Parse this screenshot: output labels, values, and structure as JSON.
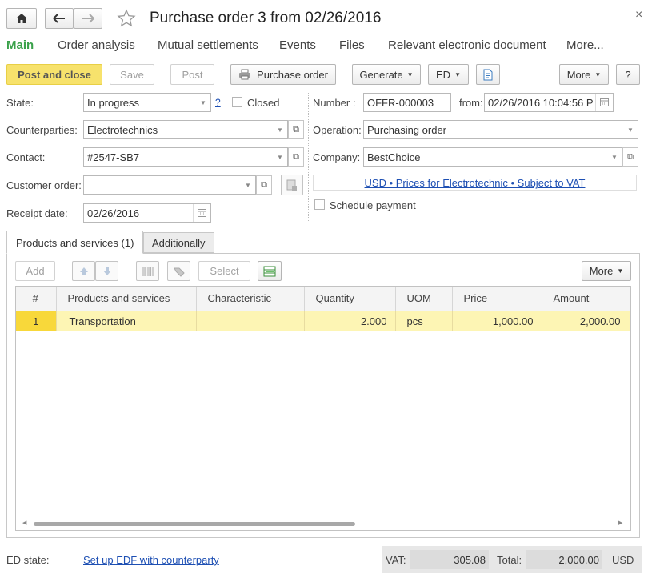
{
  "window": {
    "title": "Purchase order 3 from 02/26/2016",
    "close_glyph": "×"
  },
  "nav": {
    "home_icon": "home-icon",
    "back_icon": "arrow-left-icon",
    "forward_icon": "arrow-right-icon",
    "favorite_icon": "star-icon",
    "tabs": [
      "Main",
      "Order analysis",
      "Mutual settlements",
      "Events",
      "Files",
      "Relevant electronic document",
      "More..."
    ]
  },
  "toolbar": {
    "post_and_close": "Post and close",
    "save": "Save",
    "post": "Post",
    "purchase_order": "Purchase order",
    "generate": "Generate",
    "ed": "ED",
    "more": "More",
    "help": "?"
  },
  "form": {
    "state_label": "State:",
    "state_value": "In progress",
    "state_help": "?",
    "closed_label": "Closed",
    "counterparties_label": "Counterparties:",
    "counterparties_value": "Electrotechnics",
    "contact_label": "Contact:",
    "contact_value": "#2547-SB7",
    "customer_order_label": "Customer order:",
    "customer_order_value": "",
    "receipt_date_label": "Receipt date:",
    "receipt_date_value": "02/26/2016",
    "number_label": "Number :",
    "number_value": "OFFR-000003",
    "from_label": "from:",
    "from_value": "02/26/2016 10:04:56 P",
    "operation_label": "Operation:",
    "operation_value": "Purchasing order",
    "company_label": "Company:",
    "company_value": "BestChoice",
    "prices_link": "USD • Prices for Electrotechnic • Subject to VAT",
    "schedule_payment_label": "Schedule payment"
  },
  "tabs": {
    "products": "Products and services (1)",
    "additionally": "Additionally"
  },
  "table_toolbar": {
    "add": "Add",
    "select": "Select",
    "more": "More"
  },
  "table": {
    "columns": [
      "#",
      "Products and services",
      "Characteristic",
      "Quantity",
      "UOM",
      "Price",
      "Amount"
    ],
    "rows": [
      {
        "num": "1",
        "product": "Transportation",
        "characteristic": "",
        "quantity": "2.000",
        "uom": "pcs",
        "price": "1,000.00",
        "amount": "2,000.00"
      }
    ]
  },
  "footer": {
    "ed_state_label": "ED state:",
    "edf_link": "Set up EDF with counterparty",
    "vat_label": "VAT:",
    "vat_value": "305.08",
    "total_label": "Total:",
    "total_value": "2,000.00",
    "currency": "USD"
  },
  "colors": {
    "accent_green": "#3aa14a",
    "primary_button": "#f7e26c",
    "selected_row": "#fdf5b4",
    "link": "#1d4fb3"
  }
}
